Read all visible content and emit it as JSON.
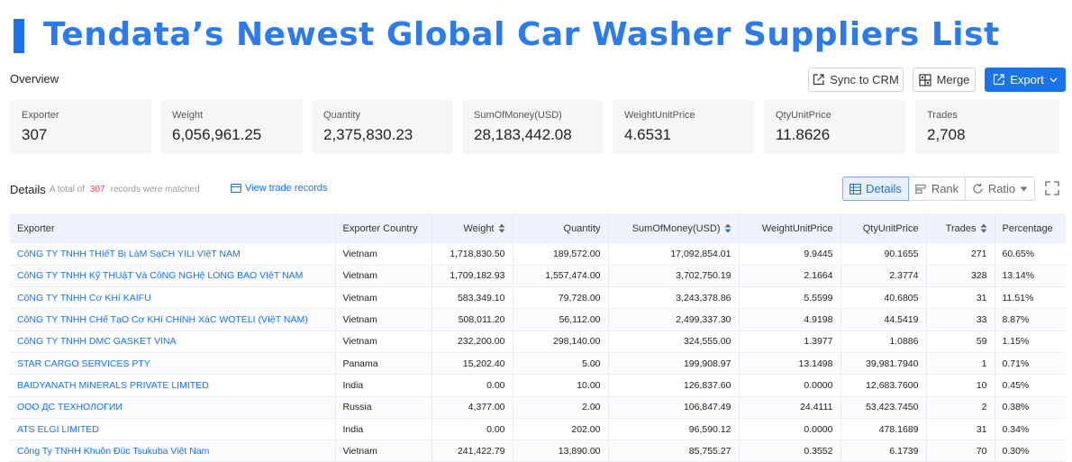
{
  "title": "Tendata’s Newest Global Car Washer Suppliers List",
  "overview_label": "Overview",
  "buttons": {
    "sync": "Sync to CRM",
    "merge": "Merge",
    "export": "Export"
  },
  "stats": [
    {
      "label": "Exporter",
      "value": "307"
    },
    {
      "label": "Weight",
      "value": "6,056,961.25"
    },
    {
      "label": "Quantity",
      "value": "2,375,830.23"
    },
    {
      "label": "SumOfMoney(USD)",
      "value": "28,183,442.08"
    },
    {
      "label": "WeightUnitPrice",
      "value": "4.6531"
    },
    {
      "label": "QtyUnitPrice",
      "value": "11.8626"
    },
    {
      "label": "Trades",
      "value": "2,708"
    }
  ],
  "details": {
    "title": "Details",
    "note_prefix": "A total of",
    "count": "307",
    "note_suffix": "records were matched",
    "view_trade": "View trade records",
    "tabs": {
      "details": "Details",
      "rank": "Rank",
      "ratio": "Ratio"
    }
  },
  "table": {
    "headers": [
      "Exporter",
      "Exporter Country",
      "Weight",
      "Quantity",
      "SumOfMoney(USD)",
      "WeightUnitPrice",
      "QtyUnitPrice",
      "Trades",
      "Percentage"
    ],
    "rows": [
      [
        "CôNG TY TNHH THIếT Bị LàM SạCH YILI VIệT NAM",
        "Vietnam",
        "1,718,830.50",
        "189,572.00",
        "17,092,854.01",
        "9.9445",
        "90.1655",
        "271",
        "60.65%"
      ],
      [
        "CôNG TY TNHH Kỹ THUậT Và CôNG NGHệ LONG BAO VIệT NAM",
        "Vietnam",
        "1,709,182.93",
        "1,557,474.00",
        "3,702,750.19",
        "2.1664",
        "2.3774",
        "328",
        "13.14%"
      ],
      [
        "CôNG TY TNHH Cơ KHí KAIFU",
        "Vietnam",
        "583,349.10",
        "79,728.00",
        "3,243,378.86",
        "5.5599",
        "40.6805",
        "31",
        "11.51%"
      ],
      [
        "CôNG TY TNHH CHế TạO Cơ KHí CHíNH XáC WOTELI (VIệT NAM)",
        "Vietnam",
        "508,011.20",
        "56,112.00",
        "2,499,337.30",
        "4.9198",
        "44.5419",
        "33",
        "8.87%"
      ],
      [
        "CôNG TY TNHH DMC GASKET VINA",
        "Vietnam",
        "232,200.00",
        "298,140.00",
        "324,555.00",
        "1.3977",
        "1.0886",
        "59",
        "1.15%"
      ],
      [
        "STAR CARGO SERVICES PTY",
        "Panama",
        "15,202.40",
        "5.00",
        "199,908.97",
        "13.1498",
        "39,981.7940",
        "1",
        "0.71%"
      ],
      [
        "BAIDYANATH MINERALS PRIVATE LIMITED",
        "India",
        "0.00",
        "10.00",
        "126,837.60",
        "0.0000",
        "12,683.7600",
        "10",
        "0.45%"
      ],
      [
        "ООО ДС ТЕХНОЛОГИИ",
        "Russia",
        "4,377.00",
        "2.00",
        "106,847.49",
        "24.4111",
        "53,423.7450",
        "2",
        "0.38%"
      ],
      [
        "ATS ELGI LIMITED",
        "India",
        "0.00",
        "202.00",
        "96,590.12",
        "0.0000",
        "478.1689",
        "31",
        "0.34%"
      ],
      [
        "Công Ty TNHH Khuôn Đúc Tsukuba Việt Nam",
        "Vietnam",
        "241,422.79",
        "13,890.00",
        "85,755.27",
        "0.3552",
        "6.1739",
        "70",
        "0.30%"
      ]
    ]
  },
  "colors": {
    "accent": "#1a73e8",
    "title": "#2b7cea",
    "count": "#e54b3c"
  },
  "icons": {
    "sync": "external-link-icon",
    "merge": "merge-grid-icon",
    "export": "export-icon",
    "details_tab": "table-icon",
    "rank_tab": "bar-rank-icon",
    "ratio_tab": "refresh-icon",
    "fullscreen": "expand-icon"
  }
}
